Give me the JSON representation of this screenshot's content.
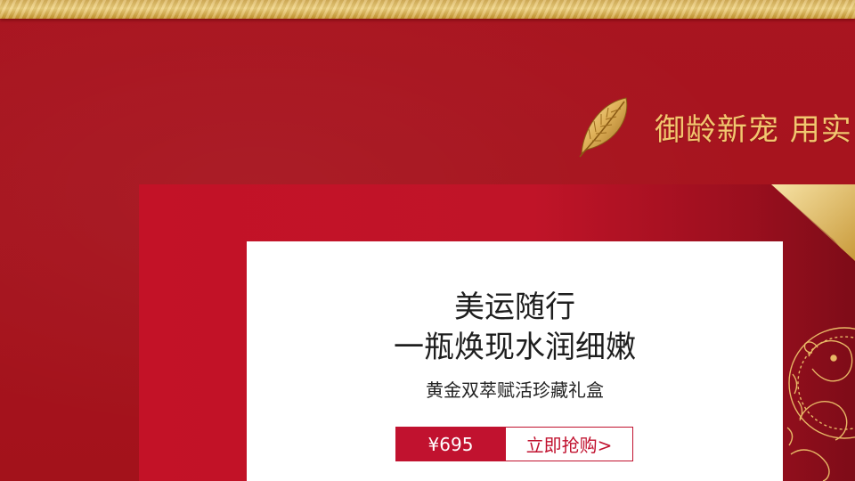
{
  "banner": {
    "headline": "御龄新宠 用实",
    "leaf_icon": "gold-leaf-icon"
  },
  "product": {
    "title_line_1": "美运随行",
    "title_line_2": "一瓶焕现水润细嫩",
    "subtitle": "黄金双萃赋活珍藏礼盒",
    "price": "¥695",
    "buy_label": "立即抢购>"
  },
  "colors": {
    "background_red": "#a8141c",
    "panel_red": "#c31227",
    "gold": "#f2c66f",
    "accent_red": "#c1122f",
    "card_white": "#ffffff"
  }
}
